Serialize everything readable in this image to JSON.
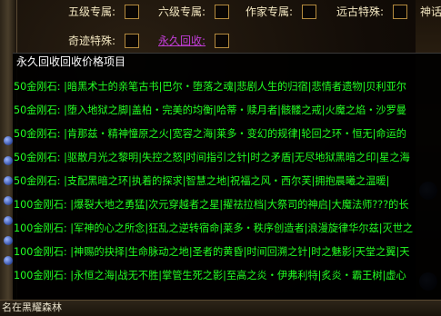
{
  "top_row": {
    "label_1": "五级专属:",
    "label_2": "六级专属:",
    "label_3": "作家专属:",
    "label_4": "远古特殊:",
    "label_5": "神话"
  },
  "second_row": {
    "label_1": "奇迹特殊:",
    "label_2": "永久回收:"
  },
  "popup": {
    "title": "永久回收回收价格项目",
    "rows": [
      "50金刚石: |暗黑术士的亲笔古书|巴尔・堕落之魂|悲剧人生的归宿|悲情者遗物|贝利亚尔",
      "50金刚石: |堕入地狱之脚|盖柏・完美的均衡|哈蒂・赎月者|骸髅之戒|火魔之焰・沙罗曼",
      "50金刚石: |肯那兹・精神憧原之火|宽容之海|莱多・变幻的规律|轮回之环・恒无|命运的",
      "50金刚石: |驱散月光之黎明|失控之怒|时间指引之针|时之矛盾|无尽地狱黑暗之印|星之海",
      "50金刚石: |支配黑暗之环|执着的探求|智慧之地|祝福之风・西尔芙|拥抱晨曦之温暖|",
      "100金刚石: |爆裂大地之勇猛|次元穿越者之星|擢祛拉档|大祭司的神启|大魔法师???的长",
      "100金刚石: |军神的心之所念|狂乱之逆转宿命|莱多・秩序创造者|浪漫旋律华尔兹|灭世之",
      "100金刚石: |神赐的抉择|生命脉动之地|圣者的黄昏|时间回溯之针|时之魅影|天堂之翼|天",
      "100金刚石: |永恒之海|战无不胜|掌管生死之影|至高之炎・伊弗利特|炙炎・霸王树|虚心"
    ]
  },
  "bottom_bar": {
    "text": "名在黑耀森林"
  }
}
